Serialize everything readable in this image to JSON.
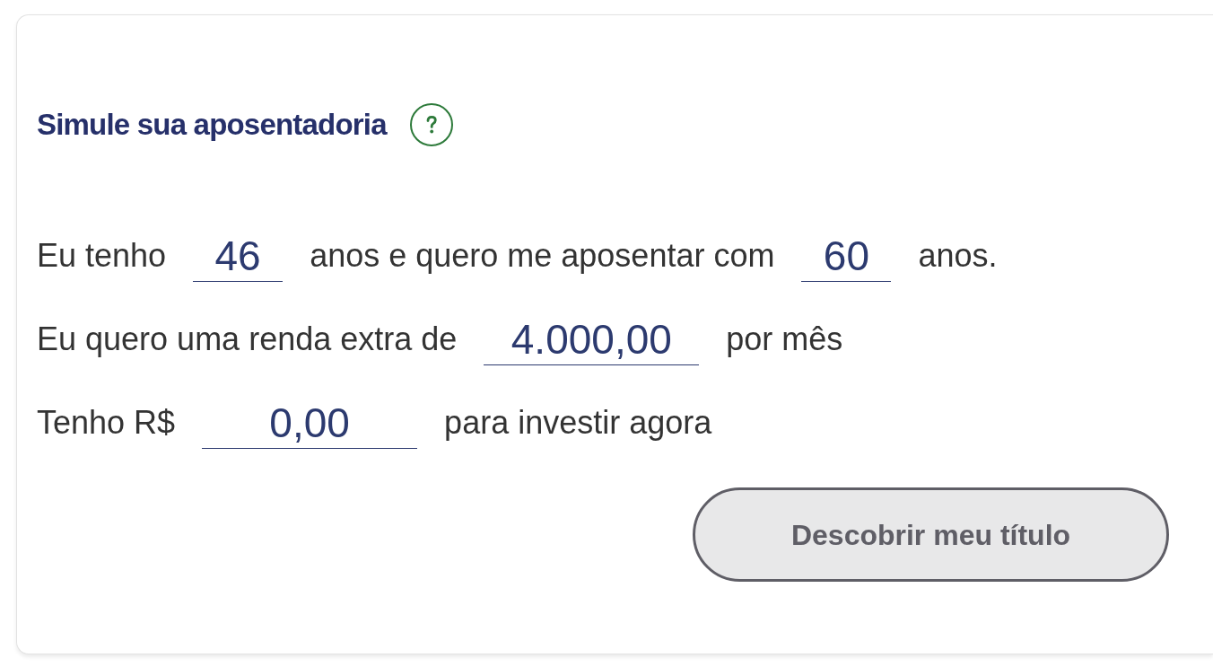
{
  "card": {
    "title": "Simule sua aposentadoria",
    "sentences": [
      {
        "parts": [
          {
            "kind": "text",
            "text": "Eu tenho"
          },
          {
            "kind": "age",
            "value": "46"
          },
          {
            "kind": "text",
            "text": "anos e quero me aposentar com"
          },
          {
            "kind": "age",
            "value": "60"
          },
          {
            "kind": "text",
            "text": "anos."
          }
        ]
      },
      {
        "parts": [
          {
            "kind": "text",
            "text": "Eu quero uma renda extra de"
          },
          {
            "kind": "amount",
            "value": "4.000,00"
          },
          {
            "kind": "text",
            "text": "por mês"
          }
        ]
      },
      {
        "parts": [
          {
            "kind": "text",
            "text": "Tenho R$"
          },
          {
            "kind": "amount",
            "value": "0,00"
          },
          {
            "kind": "text",
            "text": "para investir agora"
          }
        ]
      }
    ],
    "button": {
      "label": "Descobrir meu título"
    }
  }
}
